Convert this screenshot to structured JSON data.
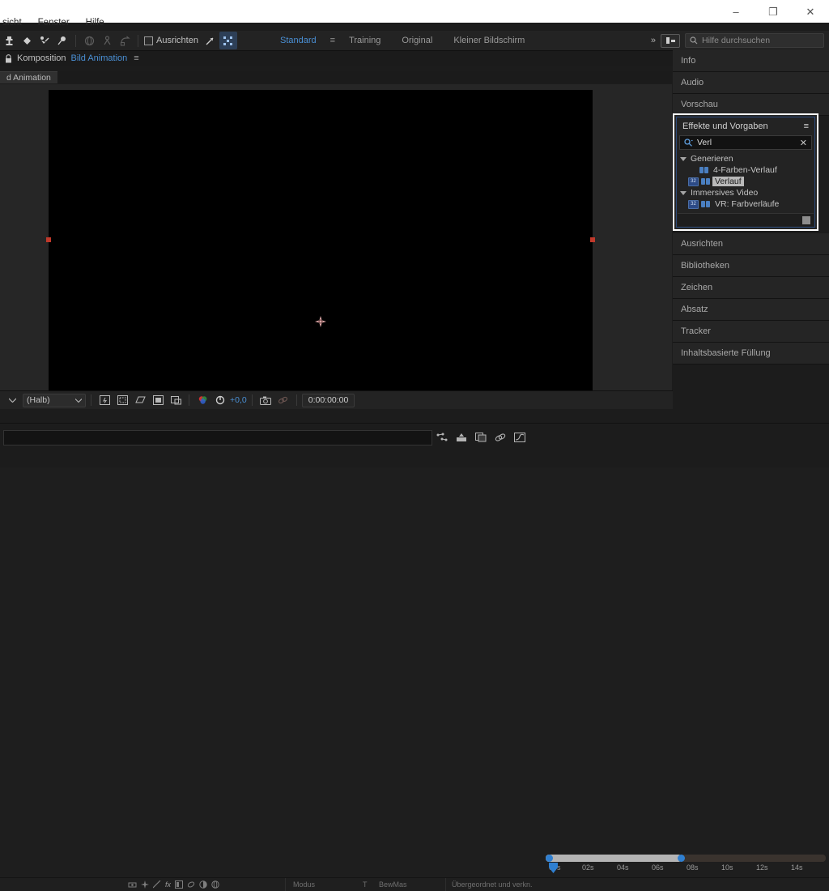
{
  "window": {
    "minimize_label": "–",
    "maximize_label": "❐",
    "close_label": "✕"
  },
  "menubar": {
    "items": [
      {
        "label": "sicht"
      },
      {
        "label": "Fenster"
      },
      {
        "label": "Hilfe"
      }
    ]
  },
  "toolbar": {
    "snap_label": "Ausrichten",
    "workspaces": [
      {
        "label": "Standard",
        "active": true
      },
      {
        "label": "Training",
        "active": false
      },
      {
        "label": "Original",
        "active": false
      },
      {
        "label": "Kleiner Bildschirm",
        "active": false
      }
    ],
    "workspace_menu_icon": "≡",
    "overflow_icon": "»",
    "help_placeholder": "Hilfe durchsuchen",
    "search_icon": "search-icon"
  },
  "composition": {
    "lock_icon": "lock-icon",
    "panel_label": "Komposition",
    "comp_name": "Bild Animation",
    "menu_icon": "≡",
    "tab_label": "d Animation"
  },
  "viewer": {
    "magnification": "(Halb)",
    "exposure_value": "+0,0",
    "timecode": "0:00:00:00"
  },
  "dock": {
    "items": [
      {
        "label": "Info"
      },
      {
        "label": "Audio"
      },
      {
        "label": "Vorschau"
      },
      {
        "label": "Ausrichten"
      },
      {
        "label": "Bibliotheken"
      },
      {
        "label": "Zeichen"
      },
      {
        "label": "Absatz"
      },
      {
        "label": "Tracker"
      },
      {
        "label": "Inhaltsbasierte Füllung"
      }
    ]
  },
  "effects_panel": {
    "title": "Effekte und Vorgaben",
    "menu_icon": "≡",
    "search_value": "Verl",
    "clear_icon": "✕",
    "categories": [
      {
        "label": "Generieren",
        "expanded": true,
        "items": [
          {
            "label": "4-Farben-Verlauf",
            "selected": false,
            "has_32": false
          },
          {
            "label": "Verlauf",
            "selected": true,
            "has_32": true
          }
        ]
      },
      {
        "label": "Immersives Video",
        "expanded": true,
        "items": [
          {
            "label": "VR: Farbverläufe",
            "selected": false,
            "has_32": true
          }
        ]
      }
    ],
    "badge_label": "32"
  },
  "timeline": {
    "ticks": [
      "00s",
      "02s",
      "04s",
      "06s",
      "08s",
      "10s",
      "12s",
      "14s"
    ],
    "columns": [
      {
        "label": "Modus"
      },
      {
        "label": "T"
      },
      {
        "label": "BewMas"
      },
      {
        "label": "Übergeordnet und verkn."
      }
    ]
  },
  "colors": {
    "accent_blue": "#4a8fd4",
    "highlight_border": "#ffffff",
    "selection_red": "#c0392b",
    "panel_bg": "#232323"
  }
}
